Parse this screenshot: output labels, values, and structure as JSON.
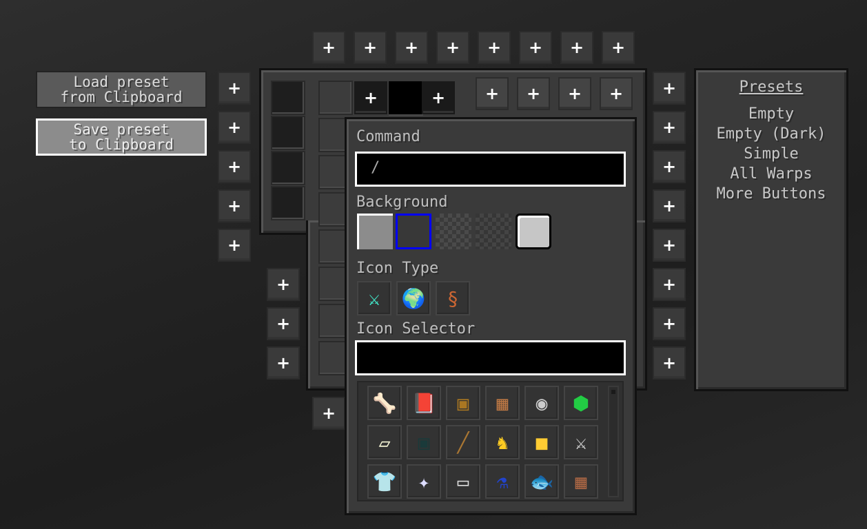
{
  "left_buttons": {
    "load": [
      "Load preset",
      "from Clipboard"
    ],
    "save": [
      "Save preset",
      "to Clipboard"
    ]
  },
  "plus_label": "+",
  "popup": {
    "command_label": "Command",
    "command_value": "/",
    "background_label": "Background",
    "background_options": [
      {
        "name": "light-gray",
        "color": "#8c8c8c"
      },
      {
        "name": "dark",
        "color": "#3a3a3a",
        "selected": true
      },
      {
        "name": "checker"
      },
      {
        "name": "checker-dark"
      },
      {
        "name": "white-rounded",
        "color": "#c6c6c6"
      }
    ],
    "icon_type_label": "Icon Type",
    "icon_types": [
      "diamond-sword-icon",
      "globe-icon",
      "lead-icon"
    ],
    "icon_selector_label": "Icon Selector",
    "icon_selector_value": "",
    "icons": [
      "bone",
      "book",
      "chest",
      "command-block",
      "compass",
      "emerald",
      "paper",
      "ender-chest",
      "fishing-rod",
      "horse-armor",
      "gold-block",
      "iron-sword",
      "leather-tunic",
      "nether-star",
      "painting",
      "potion",
      "fish",
      "crafting-table"
    ]
  },
  "presets": {
    "title": "Presets",
    "items": [
      "Empty",
      "Empty (Dark)",
      "Simple",
      "All Warps",
      "More Buttons"
    ]
  },
  "colors": {
    "selection": "#0000ff"
  }
}
